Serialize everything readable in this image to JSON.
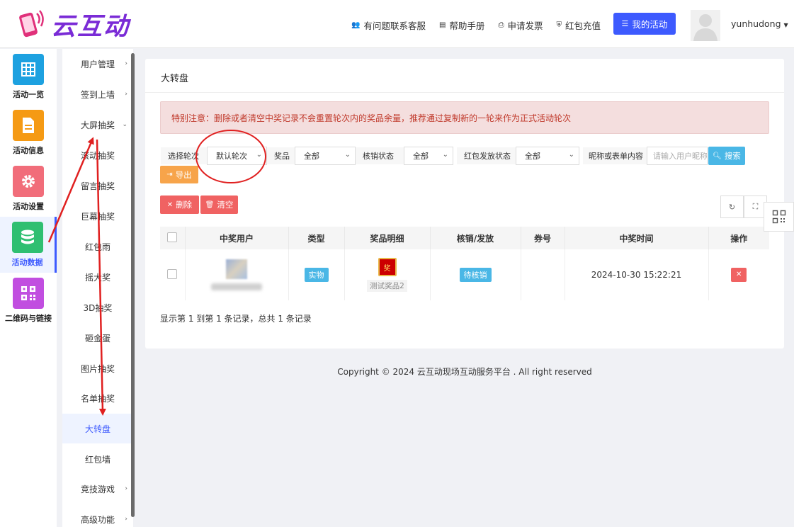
{
  "header": {
    "logo_text": "云互动",
    "nav": [
      {
        "label": "有问题联系客服",
        "icon": "user-plus-icon"
      },
      {
        "label": "帮助手册",
        "icon": "book-icon"
      },
      {
        "label": "申请发票",
        "icon": "printer-icon"
      },
      {
        "label": "红包充值",
        "icon": "shield-check-icon"
      }
    ],
    "my_activity": "我的活动",
    "username": "yunhudong"
  },
  "sidebar_main": [
    {
      "label": "活动一览",
      "color": "#1da1e0",
      "icon": "grid-icon"
    },
    {
      "label": "活动信息",
      "color": "#f59a14",
      "icon": "document-icon"
    },
    {
      "label": "活动设置",
      "color": "#f16d7a",
      "icon": "gear-icon"
    },
    {
      "label": "活动数据",
      "color": "#2fbf71",
      "icon": "database-icon",
      "active": true
    },
    {
      "label": "二维码与链接",
      "color": "#c14ee0",
      "icon": "qrcode-icon"
    }
  ],
  "sidebar_sub": [
    {
      "label": "用户管理",
      "arrow": "›"
    },
    {
      "label": "签到上墙",
      "arrow": "›"
    },
    {
      "label": "大屏抽奖",
      "arrow": "⌄"
    },
    {
      "label": "滚动抽奖"
    },
    {
      "label": "留言抽奖"
    },
    {
      "label": "巨幕抽奖"
    },
    {
      "label": "红包雨"
    },
    {
      "label": "摇大奖"
    },
    {
      "label": "3D抽奖"
    },
    {
      "label": "砸金蛋"
    },
    {
      "label": "图片抽奖"
    },
    {
      "label": "名单抽奖"
    },
    {
      "label": "大转盘",
      "active": true
    },
    {
      "label": "红包墙"
    },
    {
      "label": "竞技游戏",
      "arrow": "›"
    },
    {
      "label": "高级功能",
      "arrow": "›"
    }
  ],
  "panel": {
    "title": "大转盘",
    "notice": "特别注意：删除或者清空中奖记录不会重置轮次内的奖品余量，推荐通过复制新的一轮来作为正式活动轮次"
  },
  "filters": {
    "round_label": "选择轮次",
    "round_value": "默认轮次",
    "prize_label": "奖品",
    "prize_value": "全部",
    "verify_label": "核销状态",
    "verify_value": "全部",
    "redpack_label": "红包发放状态",
    "redpack_value": "全部",
    "keyword_label": "昵称或表单内容",
    "keyword_placeholder": "请输入用户昵称",
    "search_label": "搜索",
    "export_label": "导出"
  },
  "actions": {
    "delete_label": "删除",
    "clear_label": "清空"
  },
  "table": {
    "headers": [
      "中奖用户",
      "类型",
      "奖品明细",
      "核销/发放",
      "券号",
      "中奖时间",
      "操作"
    ],
    "rows": [
      {
        "type": "实物",
        "prize_icon_text": "奖",
        "prize_name": "测试奖品2",
        "status": "待核销",
        "code": "",
        "time": "2024-10-30 15:22:21"
      }
    ]
  },
  "pagination": "显示第 1 到第 1 条记录，总共 1 条记录",
  "footer": "Copyright © 2024 云互动现场互动服务平台 . All right reserved",
  "colors": {
    "primary": "#3d5afe",
    "info": "#4ab7e6",
    "danger": "#f06262",
    "warning": "#f7a44a",
    "annotation": "#e02020"
  }
}
